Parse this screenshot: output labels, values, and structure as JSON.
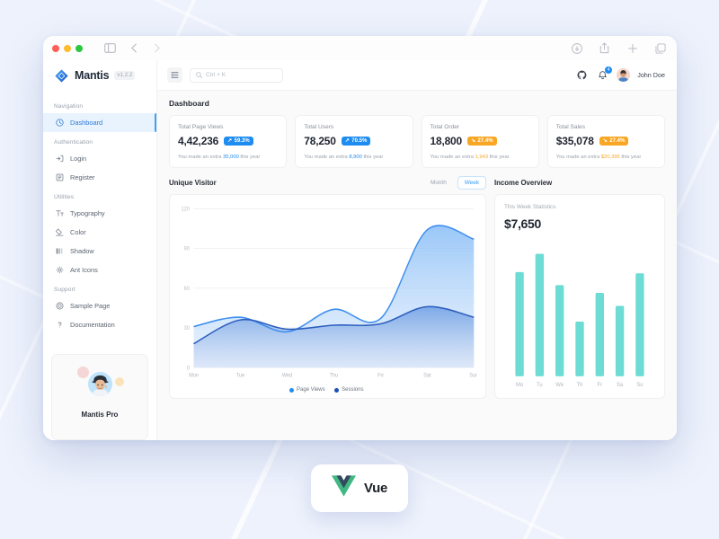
{
  "window": {
    "titlebar": {
      "traffic_lights": [
        "close",
        "minimize",
        "zoom"
      ],
      "sidebar_toggle_icon": "sidebar-icon",
      "back_icon": "chevron-left-icon",
      "forward_icon": "chevron-right-icon",
      "right_icons": [
        "download-icon",
        "share-icon",
        "plus-icon",
        "tabs-icon"
      ]
    }
  },
  "sidebar": {
    "brand": {
      "name": "Mantis",
      "version": "v1.2.2",
      "logo_icon": "mantis-diamond-logo"
    },
    "sections": [
      {
        "label": "Navigation",
        "items": [
          {
            "label": "Dashboard",
            "icon": "dashboard-icon",
            "active": true
          }
        ]
      },
      {
        "label": "Authentication",
        "items": [
          {
            "label": "Login",
            "icon": "login-icon",
            "active": false
          },
          {
            "label": "Register",
            "icon": "register-icon",
            "active": false
          }
        ]
      },
      {
        "label": "Utilities",
        "items": [
          {
            "label": "Typography",
            "icon": "typography-icon",
            "active": false
          },
          {
            "label": "Color",
            "icon": "color-icon",
            "active": false
          },
          {
            "label": "Shadow",
            "icon": "shadow-icon",
            "active": false
          },
          {
            "label": "Ant Icons",
            "icon": "ant-icons-icon",
            "active": false
          }
        ]
      },
      {
        "label": "Support",
        "items": [
          {
            "label": "Sample Page",
            "icon": "sample-page-icon",
            "active": false
          },
          {
            "label": "Documentation",
            "icon": "question-icon",
            "active": false
          }
        ]
      }
    ],
    "pro_card": {
      "title": "Mantis Pro"
    }
  },
  "topbar": {
    "menu_icon": "menu-collapse-icon",
    "search": {
      "placeholder": "Ctrl + K",
      "icon": "search-icon"
    },
    "github_icon": "github-icon",
    "notifications": {
      "icon": "bell-icon",
      "count": "4"
    },
    "user": {
      "name": "John Doe",
      "avatar": "user-avatar"
    }
  },
  "content": {
    "page_title": "Dashboard",
    "stats": [
      {
        "label": "Total Page Views",
        "value": "4,42,236",
        "chip": "59.3%",
        "chip_tone": "blue",
        "chip_arrow": "up",
        "sub_prefix": "You made an extra ",
        "sub_value": "35,000",
        "sub_suffix": " this year"
      },
      {
        "label": "Total Users",
        "value": "78,250",
        "chip": "70.5%",
        "chip_tone": "blue",
        "chip_arrow": "up",
        "sub_prefix": "You made an extra ",
        "sub_value": "8,900",
        "sub_suffix": " this year"
      },
      {
        "label": "Total Order",
        "value": "18,800",
        "chip": "27.4%",
        "chip_tone": "orange",
        "chip_arrow": "down",
        "sub_prefix": "You made an extra ",
        "sub_value": "1,943",
        "sub_suffix": " this year"
      },
      {
        "label": "Total Sales",
        "value": "$35,078",
        "chip": "27.4%",
        "chip_tone": "orange",
        "chip_arrow": "down",
        "sub_prefix": "You made an extra ",
        "sub_value": "$20,395",
        "sub_suffix": " this year"
      }
    ],
    "unique_visitor": {
      "title": "Unique Visitor",
      "range_options": [
        "Month",
        "Week"
      ],
      "range_selected": "Week"
    },
    "income_overview": {
      "title": "Income Overview",
      "subtitle": "This Week Statistics",
      "amount": "$7,650"
    }
  },
  "vue_badge": {
    "label": "Vue",
    "logo_icon": "vue-logo"
  },
  "colors": {
    "accent_blue": "#1e8cf0",
    "accent_orange": "#f8a623",
    "area_light": "#60a5f5",
    "area_dark": "#2d5fbe",
    "bar_teal": "#6ddcd4",
    "page_bg": "#eef2fc"
  },
  "chart_data": [
    {
      "type": "area",
      "title": "Unique Visitor",
      "xlabel": "",
      "ylabel": "",
      "categories": [
        "Mon",
        "Tue",
        "Wed",
        "Thu",
        "Fri",
        "Sat",
        "Sun"
      ],
      "yticks": [
        0,
        30,
        60,
        90,
        120
      ],
      "ylim": [
        0,
        120
      ],
      "grid": true,
      "legend_position": "bottom",
      "series": [
        {
          "name": "Page Views",
          "color": "#3d8ef0",
          "values": [
            31,
            38,
            27,
            44,
            37,
            104,
            97
          ]
        },
        {
          "name": "Sessions",
          "color": "#2d5fbe",
          "values": [
            18,
            36,
            29,
            32,
            33,
            46,
            38
          ]
        }
      ]
    },
    {
      "type": "bar",
      "title": "Income Overview",
      "subtitle": "This Week Statistics",
      "xlabel": "",
      "ylabel": "",
      "categories": [
        "Mo",
        "Tu",
        "We",
        "Th",
        "Fr",
        "Sa",
        "Su"
      ],
      "values": [
        80,
        94,
        70,
        42,
        64,
        54,
        79
      ],
      "ylim": [
        0,
        100
      ],
      "grid": false,
      "color": "#6ddcd4"
    }
  ]
}
